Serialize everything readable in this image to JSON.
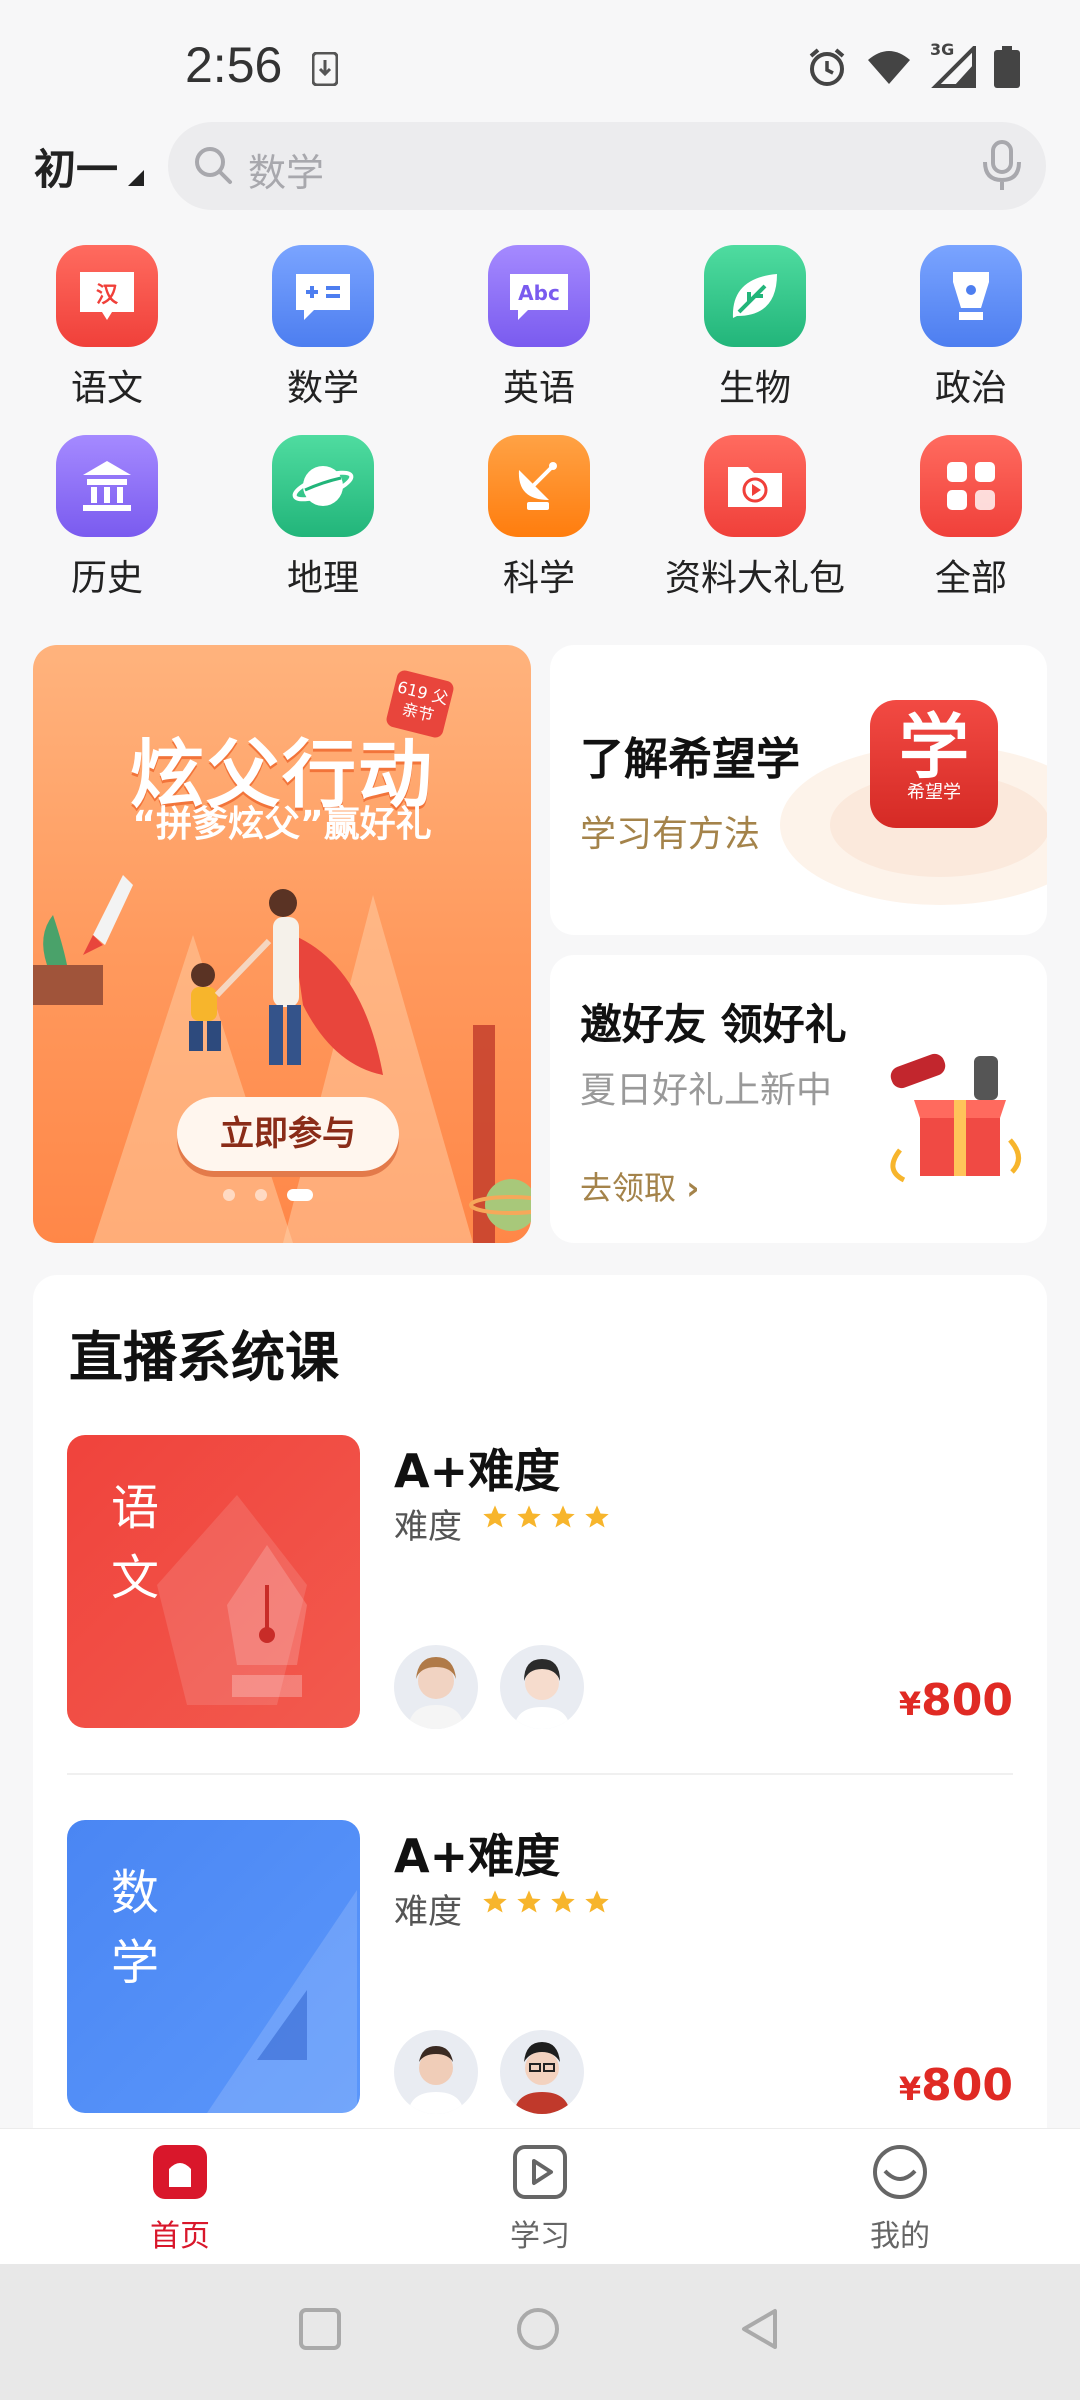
{
  "status_bar": {
    "time": "2:56",
    "network": "3G"
  },
  "header": {
    "grade": "初一",
    "search_placeholder": "数学"
  },
  "subjects": [
    {
      "label": "语文",
      "icon": "chinese-book-icon",
      "color": "#f4524c"
    },
    {
      "label": "数学",
      "icon": "math-chat-icon",
      "color": "#5d8df5"
    },
    {
      "label": "英语",
      "icon": "abc-chat-icon",
      "color": "#8b6cf2"
    },
    {
      "label": "生物",
      "icon": "leaf-icon",
      "color": "#2ec48b"
    },
    {
      "label": "政治",
      "icon": "pen-nib-icon",
      "color": "#5d8df5"
    },
    {
      "label": "历史",
      "icon": "temple-icon",
      "color": "#8b6cf2"
    },
    {
      "label": "地理",
      "icon": "planet-icon",
      "color": "#2ec48b"
    },
    {
      "label": "科学",
      "icon": "satellite-dish-icon",
      "color": "#ff8a1f"
    },
    {
      "label": "资料大礼包",
      "icon": "video-folder-icon",
      "color": "#f4524c"
    },
    {
      "label": "全部",
      "icon": "grid-icon",
      "color": "#f4524c"
    }
  ],
  "banner": {
    "title": "炫父行动",
    "subtitle": "“拼爹炫父”赢好礼",
    "tag": "619 父亲节",
    "button": "立即参与",
    "slide_index": 3,
    "slide_count": 3
  },
  "learn_card": {
    "title": "了解希望学",
    "subtitle": "学习有方法",
    "logo_big": "学",
    "logo_small": "希望学"
  },
  "invite_card": {
    "title": "邀好友 领好礼",
    "subtitle": "夏日好礼上新中",
    "link": "去领取"
  },
  "courses": {
    "heading": "直播系统课",
    "items": [
      {
        "cover_text": "语文",
        "cover_color": "#f0433c",
        "name": "A+难度",
        "difficulty_label": "难度",
        "stars": 4,
        "price_symbol": "¥",
        "price": "800"
      },
      {
        "cover_text": "数学",
        "cover_color": "#4d8cf5",
        "name": "A+难度",
        "difficulty_label": "难度",
        "stars": 4,
        "price_symbol": "¥",
        "price": "800"
      }
    ]
  },
  "tabs": [
    {
      "label": "首页",
      "icon": "home-icon",
      "active": true
    },
    {
      "label": "学习",
      "icon": "play-icon",
      "active": false
    },
    {
      "label": "我的",
      "icon": "face-icon",
      "active": false
    }
  ],
  "colors": {
    "brand": "#d9172b",
    "star": "#f7b52c",
    "price": "#e02a24"
  }
}
